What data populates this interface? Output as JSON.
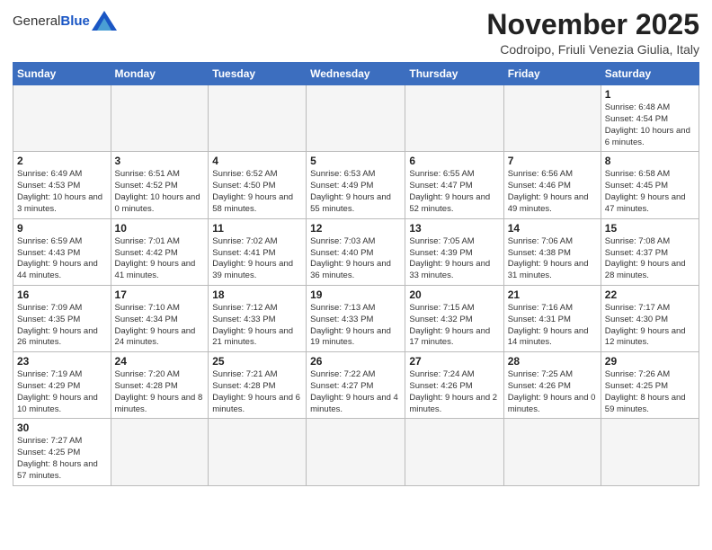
{
  "logo": {
    "text_general": "General",
    "text_blue": "Blue"
  },
  "header": {
    "month_title": "November 2025",
    "subtitle": "Codroipo, Friuli Venezia Giulia, Italy"
  },
  "weekdays": [
    "Sunday",
    "Monday",
    "Tuesday",
    "Wednesday",
    "Thursday",
    "Friday",
    "Saturday"
  ],
  "weeks": [
    [
      {
        "day": "",
        "info": ""
      },
      {
        "day": "",
        "info": ""
      },
      {
        "day": "",
        "info": ""
      },
      {
        "day": "",
        "info": ""
      },
      {
        "day": "",
        "info": ""
      },
      {
        "day": "",
        "info": ""
      },
      {
        "day": "1",
        "info": "Sunrise: 6:48 AM\nSunset: 4:54 PM\nDaylight: 10 hours and 6 minutes."
      }
    ],
    [
      {
        "day": "2",
        "info": "Sunrise: 6:49 AM\nSunset: 4:53 PM\nDaylight: 10 hours and 3 minutes."
      },
      {
        "day": "3",
        "info": "Sunrise: 6:51 AM\nSunset: 4:52 PM\nDaylight: 10 hours and 0 minutes."
      },
      {
        "day": "4",
        "info": "Sunrise: 6:52 AM\nSunset: 4:50 PM\nDaylight: 9 hours and 58 minutes."
      },
      {
        "day": "5",
        "info": "Sunrise: 6:53 AM\nSunset: 4:49 PM\nDaylight: 9 hours and 55 minutes."
      },
      {
        "day": "6",
        "info": "Sunrise: 6:55 AM\nSunset: 4:47 PM\nDaylight: 9 hours and 52 minutes."
      },
      {
        "day": "7",
        "info": "Sunrise: 6:56 AM\nSunset: 4:46 PM\nDaylight: 9 hours and 49 minutes."
      },
      {
        "day": "8",
        "info": "Sunrise: 6:58 AM\nSunset: 4:45 PM\nDaylight: 9 hours and 47 minutes."
      }
    ],
    [
      {
        "day": "9",
        "info": "Sunrise: 6:59 AM\nSunset: 4:43 PM\nDaylight: 9 hours and 44 minutes."
      },
      {
        "day": "10",
        "info": "Sunrise: 7:01 AM\nSunset: 4:42 PM\nDaylight: 9 hours and 41 minutes."
      },
      {
        "day": "11",
        "info": "Sunrise: 7:02 AM\nSunset: 4:41 PM\nDaylight: 9 hours and 39 minutes."
      },
      {
        "day": "12",
        "info": "Sunrise: 7:03 AM\nSunset: 4:40 PM\nDaylight: 9 hours and 36 minutes."
      },
      {
        "day": "13",
        "info": "Sunrise: 7:05 AM\nSunset: 4:39 PM\nDaylight: 9 hours and 33 minutes."
      },
      {
        "day": "14",
        "info": "Sunrise: 7:06 AM\nSunset: 4:38 PM\nDaylight: 9 hours and 31 minutes."
      },
      {
        "day": "15",
        "info": "Sunrise: 7:08 AM\nSunset: 4:37 PM\nDaylight: 9 hours and 28 minutes."
      }
    ],
    [
      {
        "day": "16",
        "info": "Sunrise: 7:09 AM\nSunset: 4:35 PM\nDaylight: 9 hours and 26 minutes."
      },
      {
        "day": "17",
        "info": "Sunrise: 7:10 AM\nSunset: 4:34 PM\nDaylight: 9 hours and 24 minutes."
      },
      {
        "day": "18",
        "info": "Sunrise: 7:12 AM\nSunset: 4:33 PM\nDaylight: 9 hours and 21 minutes."
      },
      {
        "day": "19",
        "info": "Sunrise: 7:13 AM\nSunset: 4:33 PM\nDaylight: 9 hours and 19 minutes."
      },
      {
        "day": "20",
        "info": "Sunrise: 7:15 AM\nSunset: 4:32 PM\nDaylight: 9 hours and 17 minutes."
      },
      {
        "day": "21",
        "info": "Sunrise: 7:16 AM\nSunset: 4:31 PM\nDaylight: 9 hours and 14 minutes."
      },
      {
        "day": "22",
        "info": "Sunrise: 7:17 AM\nSunset: 4:30 PM\nDaylight: 9 hours and 12 minutes."
      }
    ],
    [
      {
        "day": "23",
        "info": "Sunrise: 7:19 AM\nSunset: 4:29 PM\nDaylight: 9 hours and 10 minutes."
      },
      {
        "day": "24",
        "info": "Sunrise: 7:20 AM\nSunset: 4:28 PM\nDaylight: 9 hours and 8 minutes."
      },
      {
        "day": "25",
        "info": "Sunrise: 7:21 AM\nSunset: 4:28 PM\nDaylight: 9 hours and 6 minutes."
      },
      {
        "day": "26",
        "info": "Sunrise: 7:22 AM\nSunset: 4:27 PM\nDaylight: 9 hours and 4 minutes."
      },
      {
        "day": "27",
        "info": "Sunrise: 7:24 AM\nSunset: 4:26 PM\nDaylight: 9 hours and 2 minutes."
      },
      {
        "day": "28",
        "info": "Sunrise: 7:25 AM\nSunset: 4:26 PM\nDaylight: 9 hours and 0 minutes."
      },
      {
        "day": "29",
        "info": "Sunrise: 7:26 AM\nSunset: 4:25 PM\nDaylight: 8 hours and 59 minutes."
      }
    ],
    [
      {
        "day": "30",
        "info": "Sunrise: 7:27 AM\nSunset: 4:25 PM\nDaylight: 8 hours and 57 minutes."
      },
      {
        "day": "",
        "info": ""
      },
      {
        "day": "",
        "info": ""
      },
      {
        "day": "",
        "info": ""
      },
      {
        "day": "",
        "info": ""
      },
      {
        "day": "",
        "info": ""
      },
      {
        "day": "",
        "info": ""
      }
    ]
  ]
}
